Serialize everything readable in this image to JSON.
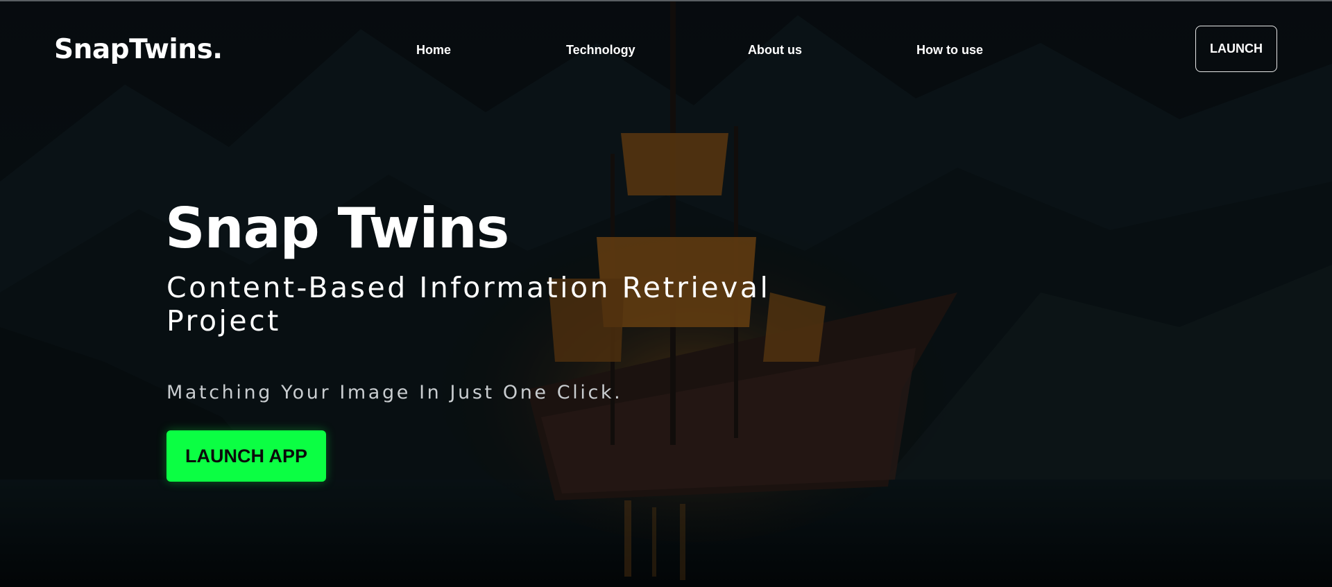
{
  "header": {
    "logo": "SnapTwins.",
    "nav": [
      {
        "label": "Home"
      },
      {
        "label": "Technology"
      },
      {
        "label": "About us"
      },
      {
        "label": "How to use"
      }
    ],
    "launch_label": "LAUNCH"
  },
  "hero": {
    "title": "Snap Twins",
    "subtitle": "Content-Based Information Retrieval Project",
    "tagline": "Matching Your Image In Just One Click.",
    "cta_label": "LAUNCH APP"
  },
  "colors": {
    "accent": "#0bff43",
    "background": "#05080b",
    "text": "#ffffff"
  }
}
